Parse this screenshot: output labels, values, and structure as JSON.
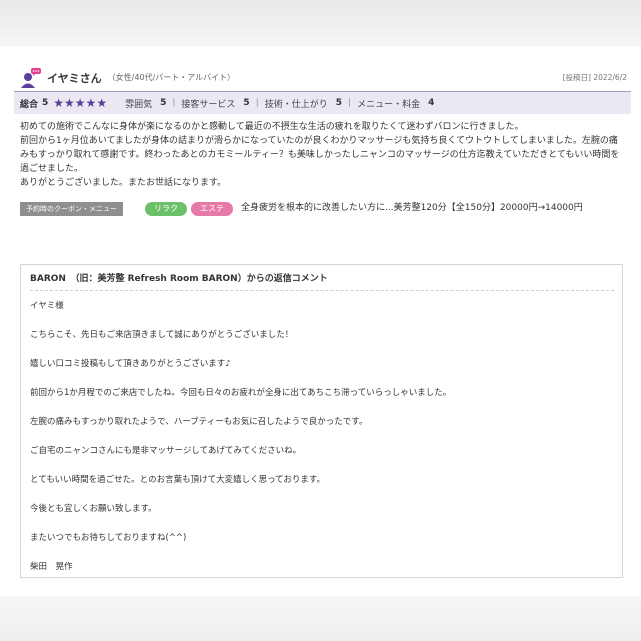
{
  "review": {
    "reviewer_name": "イヤミさん",
    "reviewer_info": "（女性/40代/パート・アルバイト）",
    "post_date": "[投稿日] 2022/6/2",
    "ratings": {
      "overall_label": "総合",
      "overall_value": "5",
      "stars": "★★★★★",
      "items": [
        {
          "label": "雰囲気",
          "value": "5"
        },
        {
          "label": "接客サービス",
          "value": "5"
        },
        {
          "label": "技術・仕上がり",
          "value": "5"
        },
        {
          "label": "メニュー・料金",
          "value": "4"
        }
      ]
    },
    "comment_lines": [
      "初めての施術でこんなに身体が楽になるのかと感動して最近の不摂生な生活の疲れを取りたくて迷わずバロンに行きました。",
      "前回から1ヶ月位あいてましたが身体の詰まりが滑らかになっていたのが良くわかりマッサージも気持ち良くてウトウトしてしまいました。左腕の痛みもすっかり取れて感謝です。終わったあとのカモミールティー？も美味しかったしニャンコのマッサージの仕方迄教えていただきとてもいい時間を過ごせました。",
      "ありがとうございました。またお世話になります。"
    ],
    "coupon_label": "予約時のクーポン・メニュー",
    "tags": [
      "リラク",
      "エステ"
    ],
    "coupon_text": "全身疲労を根本的に改善したい方に...美芳整120分【全150分】20000円→14000円"
  },
  "reply": {
    "title": "BARON　（旧：美芳整 Refresh Room BARON）からの返信コメント",
    "lines": [
      "イヤミ様",
      "こちらこそ、先日もご来店頂きまして誠にありがとうございました！",
      "嬉しい口コミ投稿もして頂きありがとうございます♪",
      "前回から1か月程でのご来店でしたね。今回も日々のお疲れが全身に出てあちこち滞っていらっしゃいました。",
      "左腕の痛みもすっかり取れたようで、ハーブティーもお気に召したようで良かったです。",
      "ご自宅のニャンコさんにも是非マッサージしてあげてみてくださいね。",
      "とてもいい時間を過ごせた。とのお言葉も頂けて大変嬉しく思っております。",
      "今後とも宜しくお願い致します。",
      "またいつでもお待ちしておりますね(^^)",
      "柴田　晃作"
    ]
  },
  "colors": {
    "accent_purple": "#5a3f99",
    "rating_bg": "#ece8f3",
    "tag_green": "#6cc069",
    "tag_pink": "#e57aa7"
  }
}
